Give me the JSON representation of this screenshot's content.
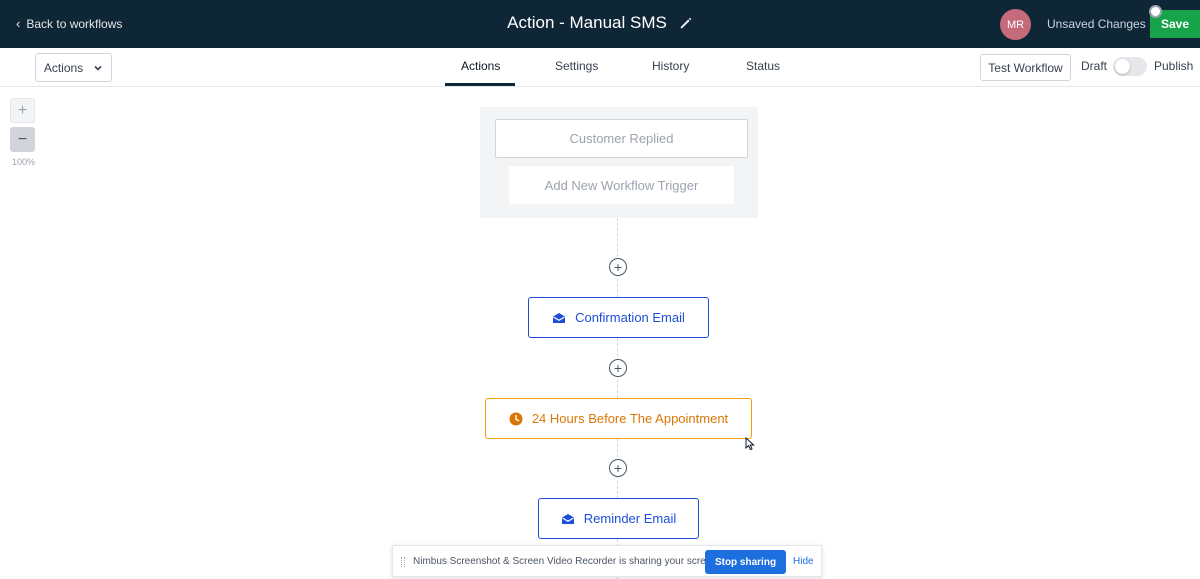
{
  "header": {
    "back_label": "Back to workflows",
    "title": "Action - Manual SMS",
    "avatar_initials": "MR",
    "unsaved_label": "Unsaved Changes",
    "save_label": "Save"
  },
  "toolbar": {
    "actions_dropdown": "Actions",
    "tabs": [
      {
        "label": "Actions",
        "active": true
      },
      {
        "label": "Settings",
        "active": false
      },
      {
        "label": "History",
        "active": false
      },
      {
        "label": "Status",
        "active": false
      }
    ],
    "test_workflow_label": "Test Workflow",
    "draft_label": "Draft",
    "publish_label": "Publish",
    "published": false
  },
  "canvas": {
    "zoom_in": "+",
    "zoom_out": "−",
    "zoom_level": "100%",
    "trigger": "Customer Replied",
    "add_trigger": "Add New Workflow Trigger",
    "nodes": [
      {
        "label": "Confirmation Email",
        "type": "email",
        "icon": "envelope-icon"
      },
      {
        "label": "24 Hours Before The Appointment",
        "type": "wait",
        "icon": "clock-icon"
      },
      {
        "label": "Reminder Email",
        "type": "email",
        "icon": "envelope-icon"
      }
    ]
  },
  "share_banner": {
    "message": "Nimbus Screenshot & Screen Video Recorder is sharing your screen.",
    "stop_label": "Stop sharing",
    "hide_label": "Hide"
  },
  "colors": {
    "header_bg": "#0f2636",
    "save_green": "#16a34a",
    "email_blue": "#1d4ed8",
    "wait_orange": "#d97706",
    "avatar": "#c46a7b"
  }
}
